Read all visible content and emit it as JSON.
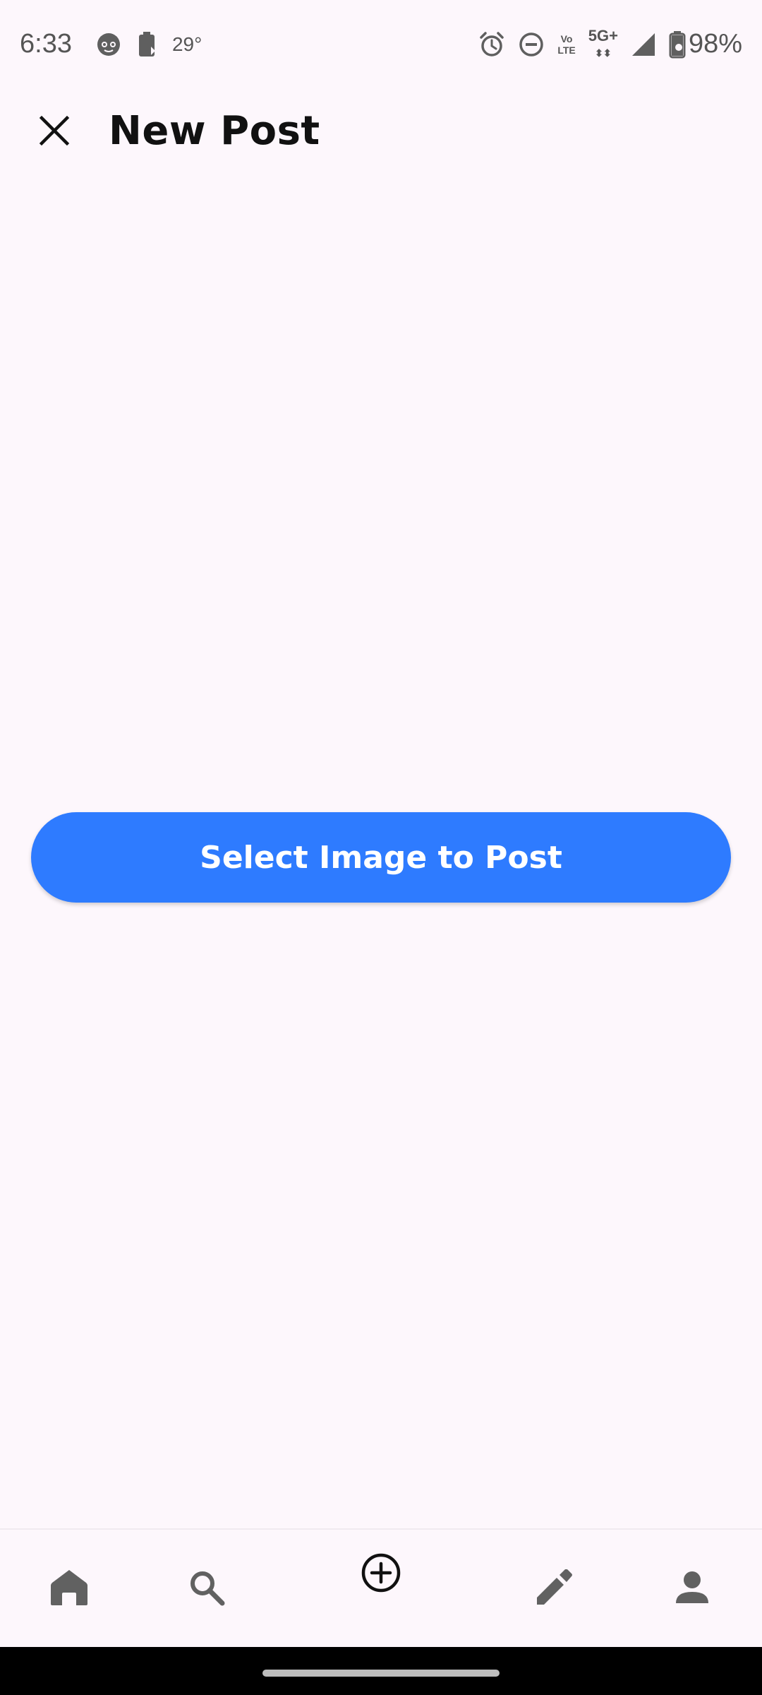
{
  "status_bar": {
    "time": "6:33",
    "temperature": "29°",
    "network_vo": "Vo",
    "network_lte": "LTE",
    "network_5g": "5G+",
    "battery": "98%",
    "icons": [
      "face-icon",
      "battery-saver-icon",
      "alarm-icon",
      "do-not-disturb-icon",
      "volte-icon",
      "5g-icon",
      "signal-icon",
      "battery-icon"
    ]
  },
  "app_bar": {
    "title": "New Post",
    "close_icon": "close-icon"
  },
  "main": {
    "select_button_label": "Select Image to Post"
  },
  "bottom_nav": {
    "items": [
      {
        "icon": "home-icon"
      },
      {
        "icon": "search-icon"
      },
      {
        "icon": "add-circle-icon"
      },
      {
        "icon": "edit-icon"
      },
      {
        "icon": "person-icon"
      }
    ]
  },
  "colors": {
    "background": "#FDF7FC",
    "accent": "#2E7BFF",
    "nav_icon": "#616161",
    "text": "#111111"
  }
}
